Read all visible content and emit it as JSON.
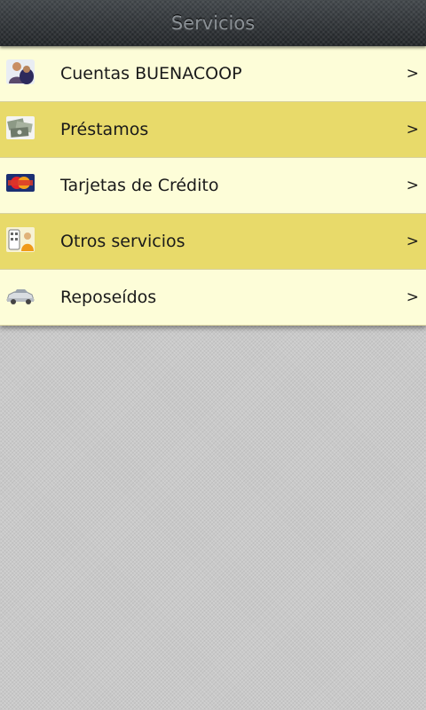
{
  "header": {
    "title": "Servicios"
  },
  "menu": {
    "items": [
      {
        "label": "Cuentas BUENACOOP",
        "arrow": ">",
        "icon": "person-icon"
      },
      {
        "label": "Préstamos",
        "arrow": ">",
        "icon": "money-icon"
      },
      {
        "label": "Tarjetas de Crédito",
        "arrow": ">",
        "icon": "credit-card-icon"
      },
      {
        "label": "Otros servicios",
        "arrow": ">",
        "icon": "services-icon"
      },
      {
        "label": "Reposeídos",
        "arrow": ">",
        "icon": "car-icon"
      }
    ]
  },
  "colors": {
    "row_light": "#fdfdd8",
    "row_dark": "#e8da6a",
    "titlebar": "#2c3034",
    "background": "#c9c9c9"
  }
}
